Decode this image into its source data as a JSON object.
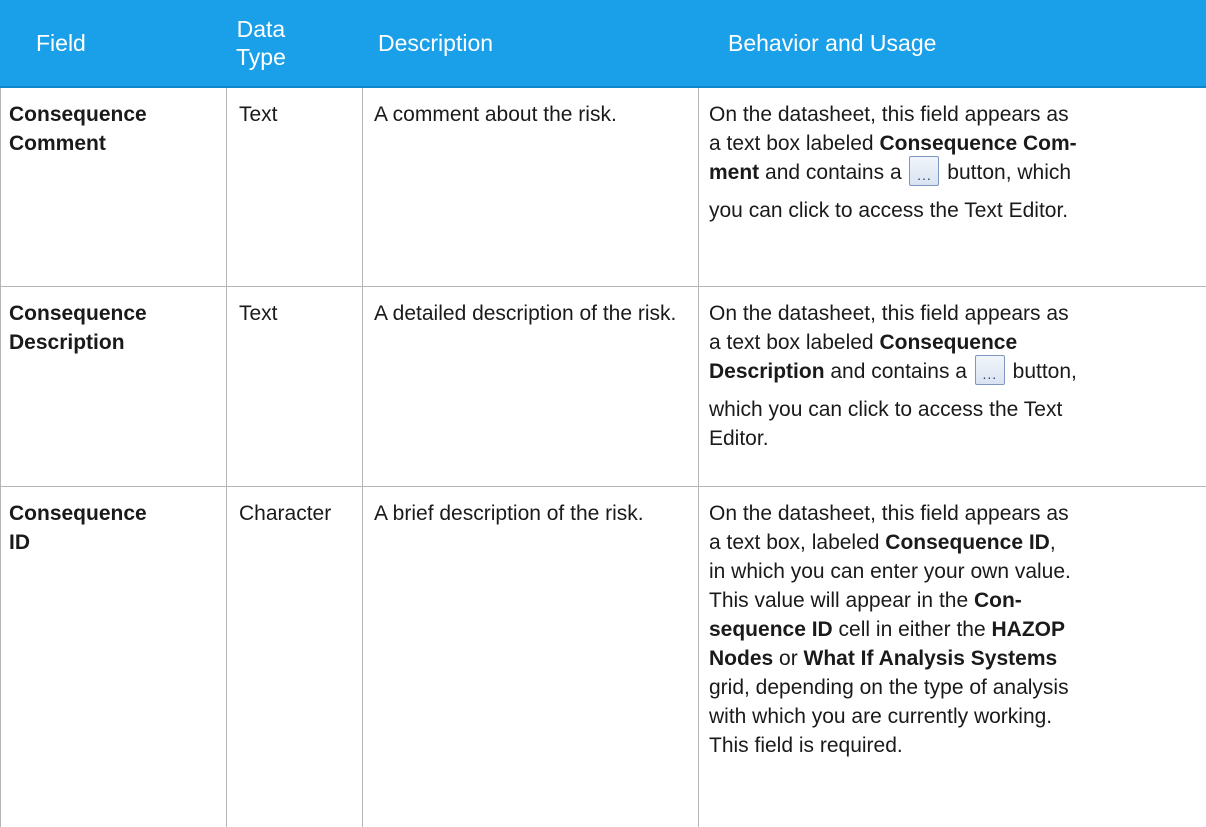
{
  "headers": {
    "field": "Field",
    "data_type_line1": "Data",
    "data_type_line2": "Type",
    "description": "Description",
    "behavior": "Behavior and Usage"
  },
  "rows": [
    {
      "field_line1": "Consequence",
      "field_line2": "Comment",
      "data_type": "Text",
      "description": "A comment about the risk.",
      "behavior": {
        "t1": "On the datasheet, this field appears as",
        "t2": "a text box labeled ",
        "b1": "Consequence Com-",
        "b2": "ment",
        "t3": " and contains a ",
        "btn": "...",
        "t4": " button, which",
        "t5": "you can click to access the Text Editor."
      }
    },
    {
      "field_line1": "Consequence",
      "field_line2": "Description",
      "data_type": "Text",
      "description": "A detailed description of the risk.",
      "behavior": {
        "t1": "On the datasheet, this field appears as",
        "t2": "a text box labeled ",
        "b1": "Consequence",
        "b2": "Description",
        "t3": " and contains a ",
        "btn": "...",
        "t4": " button,",
        "t5": "which you can click to access the Text",
        "t6": "Editor."
      }
    },
    {
      "field_line1": "Consequence",
      "field_line2": "ID",
      "data_type": "Character",
      "description": "A brief description of the risk.",
      "behavior": {
        "t1": "On the datasheet, this field appears as",
        "t2": "a text box, labeled ",
        "b1": "Consequence ID",
        "t3": ",",
        "t4": "in which you can enter your own value.",
        "t5": "This value will appear in the ",
        "b2": "Con-",
        "b3": "sequence ID",
        "t6": " cell in either the ",
        "b4": "HAZOP",
        "b5": "Nodes",
        "t7": " or ",
        "b6": "What If Analysis Systems",
        "t8": "grid, depending on the type of analysis",
        "t9": "with which you are currently working.",
        "t10": "This field is required."
      }
    }
  ]
}
